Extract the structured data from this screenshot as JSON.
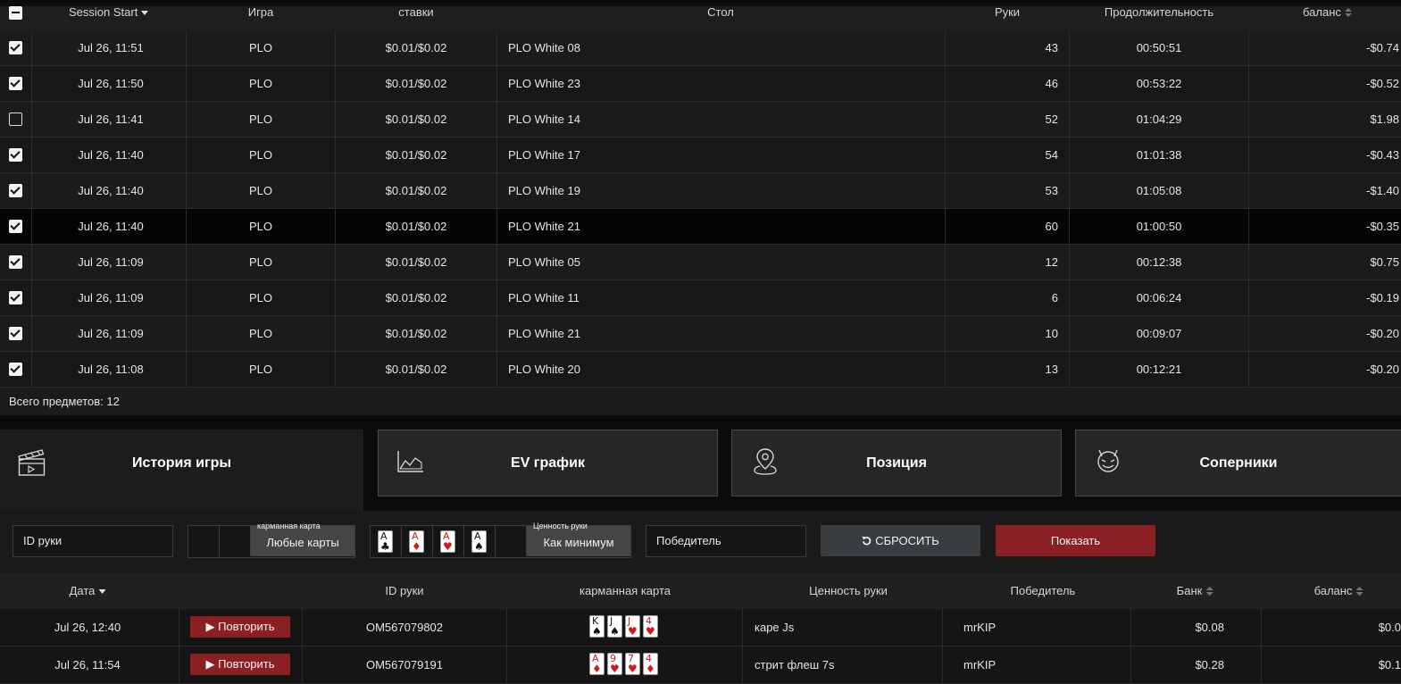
{
  "sessions": {
    "headers": {
      "session_start": "Session Start",
      "game": "Игра",
      "stakes": "ставки",
      "table": "Стол",
      "hands": "Руки",
      "duration": "Продолжительность",
      "balance": "баланс"
    },
    "rows": [
      {
        "checked": true,
        "start": "Jul 26, 11:51",
        "game": "PLO",
        "stakes": "$0.01/$0.02",
        "table": "PLO White 08",
        "hands": "43",
        "duration": "00:50:51",
        "balance": "-$0.74"
      },
      {
        "checked": true,
        "start": "Jul 26, 11:50",
        "game": "PLO",
        "stakes": "$0.01/$0.02",
        "table": "PLO White 23",
        "hands": "46",
        "duration": "00:53:22",
        "balance": "-$0.52"
      },
      {
        "checked": false,
        "start": "Jul 26, 11:41",
        "game": "PLO",
        "stakes": "$0.01/$0.02",
        "table": "PLO White 14",
        "hands": "52",
        "duration": "01:04:29",
        "balance": "$1.98"
      },
      {
        "checked": true,
        "start": "Jul 26, 11:40",
        "game": "PLO",
        "stakes": "$0.01/$0.02",
        "table": "PLO White 17",
        "hands": "54",
        "duration": "01:01:38",
        "balance": "-$0.43"
      },
      {
        "checked": true,
        "start": "Jul 26, 11:40",
        "game": "PLO",
        "stakes": "$0.01/$0.02",
        "table": "PLO White 19",
        "hands": "53",
        "duration": "01:05:08",
        "balance": "-$1.40"
      },
      {
        "checked": true,
        "start": "Jul 26, 11:40",
        "game": "PLO",
        "stakes": "$0.01/$0.02",
        "table": "PLO White 21",
        "hands": "60",
        "duration": "01:00:50",
        "balance": "-$0.35"
      },
      {
        "checked": true,
        "start": "Jul 26, 11:09",
        "game": "PLO",
        "stakes": "$0.01/$0.02",
        "table": "PLO White 05",
        "hands": "12",
        "duration": "00:12:38",
        "balance": "$0.75"
      },
      {
        "checked": true,
        "start": "Jul 26, 11:09",
        "game": "PLO",
        "stakes": "$0.01/$0.02",
        "table": "PLO White 11",
        "hands": "6",
        "duration": "00:06:24",
        "balance": "-$0.19"
      },
      {
        "checked": true,
        "start": "Jul 26, 11:09",
        "game": "PLO",
        "stakes": "$0.01/$0.02",
        "table": "PLO White 21",
        "hands": "10",
        "duration": "00:09:07",
        "balance": "-$0.20"
      },
      {
        "checked": true,
        "start": "Jul 26, 11:08",
        "game": "PLO",
        "stakes": "$0.01/$0.02",
        "table": "PLO White 20",
        "hands": "13",
        "duration": "00:12:21",
        "balance": "-$0.20"
      }
    ],
    "total_label": "Всего предметов: 12"
  },
  "tabs": [
    {
      "label": "История игры",
      "icon": "clapperboard-icon",
      "active": true
    },
    {
      "label": "EV график",
      "icon": "area-chart-icon",
      "active": false
    },
    {
      "label": "Позиция",
      "icon": "location-pin-icon",
      "active": false
    },
    {
      "label": "Соперники",
      "icon": "devil-face-icon",
      "active": false
    }
  ],
  "filters": {
    "hand_id_placeholder": "ID руки",
    "hole_card_label": "карманная карта",
    "hole_card_value": "Любые карты",
    "hand_value_label": "Ценность руки",
    "hand_value_cards": [
      {
        "rank": "A",
        "suit": "♣",
        "color": "#111111"
      },
      {
        "rank": "A",
        "suit": "♦",
        "color": "#d21a1a"
      },
      {
        "rank": "A",
        "suit": "♥",
        "color": "#d21a1a"
      },
      {
        "rank": "A",
        "suit": "♠",
        "color": "#111111"
      }
    ],
    "hand_value_select": "Как минимум",
    "winner_placeholder": "Победитель",
    "reset_label": "СБРОСИТЬ",
    "show_label": "Показать"
  },
  "hands": {
    "headers": {
      "date": "Дата",
      "hand_id": "ID руки",
      "hole_cards": "карманная карта",
      "hand_value": "Ценность руки",
      "winner": "Победитель",
      "pot": "Банк",
      "balance": "баланс"
    },
    "replay_label": "Повторить",
    "rows": [
      {
        "date": "Jul 26, 12:40",
        "hand_id": "OM567079802",
        "cards": [
          {
            "rank": "K",
            "suit": "♠",
            "color": "#111111"
          },
          {
            "rank": "J",
            "suit": "♠",
            "color": "#111111"
          },
          {
            "rank": "J",
            "suit": "♥",
            "color": "#d21a1a"
          },
          {
            "rank": "4",
            "suit": "♥",
            "color": "#d21a1a"
          }
        ],
        "hand_value": "каре Js",
        "winner": "mrKIP",
        "pot": "$0.08",
        "balance": "$0.0"
      },
      {
        "date": "Jul 26, 11:54",
        "hand_id": "OM567079191",
        "cards": [
          {
            "rank": "A",
            "suit": "♦",
            "color": "#d21a1a"
          },
          {
            "rank": "9",
            "suit": "♥",
            "color": "#d21a1a"
          },
          {
            "rank": "7",
            "suit": "♥",
            "color": "#d21a1a"
          },
          {
            "rank": "4",
            "suit": "♦",
            "color": "#d21a1a"
          }
        ],
        "hand_value": "стрит флеш 7s",
        "winner": "mrKIP",
        "pot": "$0.28",
        "balance": "$0.1"
      }
    ]
  }
}
